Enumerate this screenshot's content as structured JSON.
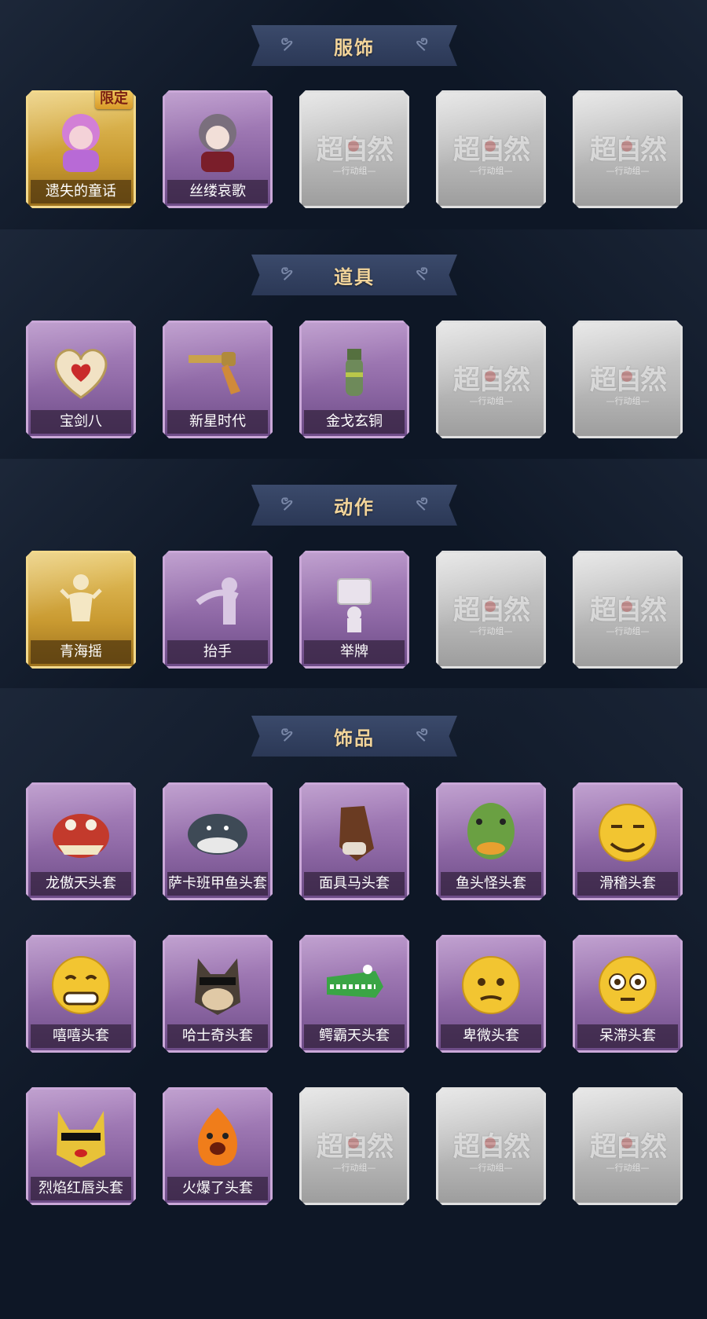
{
  "sections": [
    {
      "title": "服饰",
      "cards": [
        {
          "name": "遗失的童话",
          "rarity": "gold",
          "icon": "girl-portrait-icon",
          "badge": "限定"
        },
        {
          "name": "丝缕哀歌",
          "rarity": "purple",
          "icon": "doll-portrait-icon"
        },
        {
          "rarity": "blank",
          "watermark": "超自然",
          "watermark_sub": "—行动组—"
        },
        {
          "rarity": "blank",
          "watermark": "超自然",
          "watermark_sub": "—行动组—"
        },
        {
          "rarity": "blank",
          "watermark": "超自然",
          "watermark_sub": "—行动组—"
        }
      ]
    },
    {
      "title": "道具",
      "cards": [
        {
          "name": "宝剑八",
          "rarity": "purple",
          "icon": "heart-locket-icon"
        },
        {
          "name": "新星时代",
          "rarity": "purple",
          "icon": "revolver-icon"
        },
        {
          "name": "金戈玄铜",
          "rarity": "purple",
          "icon": "grenade-icon"
        },
        {
          "rarity": "blank",
          "watermark": "超自然",
          "watermark_sub": "—行动组—"
        },
        {
          "rarity": "blank",
          "watermark": "超自然",
          "watermark_sub": "—行动组—"
        }
      ]
    },
    {
      "title": "动作",
      "cards": [
        {
          "name": "青海摇",
          "rarity": "gold",
          "icon": "dance-pose-icon"
        },
        {
          "name": "抬手",
          "rarity": "purple",
          "icon": "raise-hand-icon"
        },
        {
          "name": "举牌",
          "rarity": "purple",
          "icon": "hold-sign-icon"
        },
        {
          "rarity": "blank",
          "watermark": "超自然",
          "watermark_sub": "—行动组—"
        },
        {
          "rarity": "blank",
          "watermark": "超自然",
          "watermark_sub": "—行动组—"
        }
      ]
    },
    {
      "title": "饰品",
      "rows": [
        [
          {
            "name": "龙傲天头套",
            "rarity": "purple",
            "icon": "dragon-mask-icon"
          },
          {
            "name": "萨卡班甲鱼头套",
            "rarity": "purple",
            "icon": "fish-mask-icon"
          },
          {
            "name": "面具马头套",
            "rarity": "purple",
            "icon": "horse-mask-icon"
          },
          {
            "name": "鱼头怪头套",
            "rarity": "purple",
            "icon": "green-fish-mask-icon"
          },
          {
            "name": "滑稽头套",
            "rarity": "purple",
            "icon": "smirk-emoji-mask-icon"
          }
        ],
        [
          {
            "name": "嘻嘻头套",
            "rarity": "purple",
            "icon": "grin-emoji-mask-icon"
          },
          {
            "name": "哈士奇头套",
            "rarity": "purple",
            "icon": "husky-mask-icon"
          },
          {
            "name": "鳄霸天头套",
            "rarity": "purple",
            "icon": "crocodile-mask-icon"
          },
          {
            "name": "卑微头套",
            "rarity": "purple",
            "icon": "humble-emoji-mask-icon"
          },
          {
            "name": "呆滞头套",
            "rarity": "purple",
            "icon": "dazed-emoji-mask-icon"
          }
        ],
        [
          {
            "name": "烈焰红唇头套",
            "rarity": "purple",
            "icon": "pikachu-mask-icon"
          },
          {
            "name": "火爆了头套",
            "rarity": "purple",
            "icon": "fire-mask-icon"
          },
          {
            "rarity": "blank",
            "watermark": "超自然",
            "watermark_sub": "—行动组—"
          },
          {
            "rarity": "blank",
            "watermark": "超自然",
            "watermark_sub": "—行动组—"
          },
          {
            "rarity": "blank",
            "watermark": "超自然",
            "watermark_sub": "—行动组—"
          }
        ]
      ]
    }
  ],
  "colors": {
    "background": "#0b1320",
    "banner": "#2f3c5c",
    "title": "#f2d49a",
    "purple_card": "#9a72b0",
    "gold_card": "#d4a73f",
    "blank_card": "#bdbdbd"
  }
}
